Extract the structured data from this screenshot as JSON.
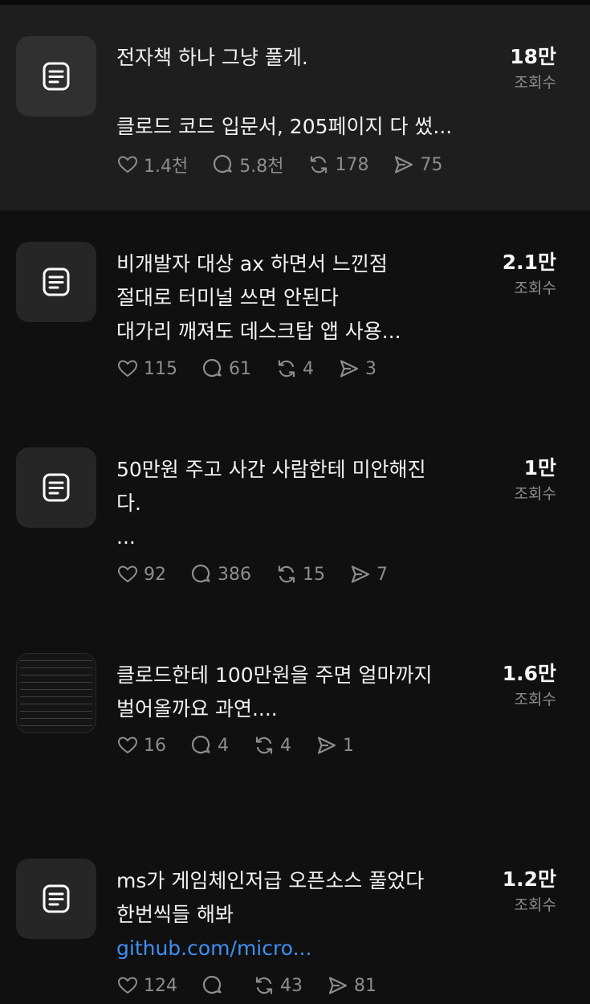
{
  "views_unit": "조회수",
  "posts": [
    {
      "lines": [
        "전자책 하나 그냥 풀게.",
        "",
        "클로드 코드 입문서, 205페이지 다 썼..."
      ],
      "link": "",
      "views": "18만",
      "likes": "1.4천",
      "replies": "5.8천",
      "reposts": "178",
      "shares": "75",
      "thumbnail": "document-icon"
    },
    {
      "lines": [
        "비개발자 대상 ax 하면서 느낀점",
        "절대로 터미널 쓰면 안된다",
        "대가리 깨져도 데스크탑 앱 사용..."
      ],
      "link": "",
      "views": "2.1만",
      "likes": "115",
      "replies": "61",
      "reposts": "4",
      "shares": "3",
      "thumbnail": "document-icon"
    },
    {
      "lines": [
        "50만원 주고 사간 사람한테 미안해진",
        "다.",
        "..."
      ],
      "link": "",
      "views": "1만",
      "likes": "92",
      "replies": "386",
      "reposts": "15",
      "shares": "7",
      "thumbnail": "document-icon"
    },
    {
      "lines": [
        "클로드한테 100만원을 주면 얼마까지",
        "벌어올까요 과연...."
      ],
      "link": "",
      "views": "1.6만",
      "likes": "16",
      "replies": "4",
      "reposts": "4",
      "shares": "1",
      "thumbnail": "image"
    },
    {
      "lines": [
        "ms가 게임체인저급 오픈소스 풀었다",
        "한번씩들 해봐"
      ],
      "link": "github.com/micro...",
      "views": "1.2만",
      "likes": "124",
      "replies": "",
      "reposts": "43",
      "shares": "81",
      "thumbnail": "document-icon"
    }
  ],
  "icons": {
    "like": "heart-icon",
    "reply": "comment-icon",
    "repost": "repost-icon",
    "share": "send-icon"
  },
  "colors": {
    "background": "#101010",
    "highlight_row": "#1e1e1e",
    "link": "#3f8ff2",
    "muted": "#8d8d8d"
  }
}
